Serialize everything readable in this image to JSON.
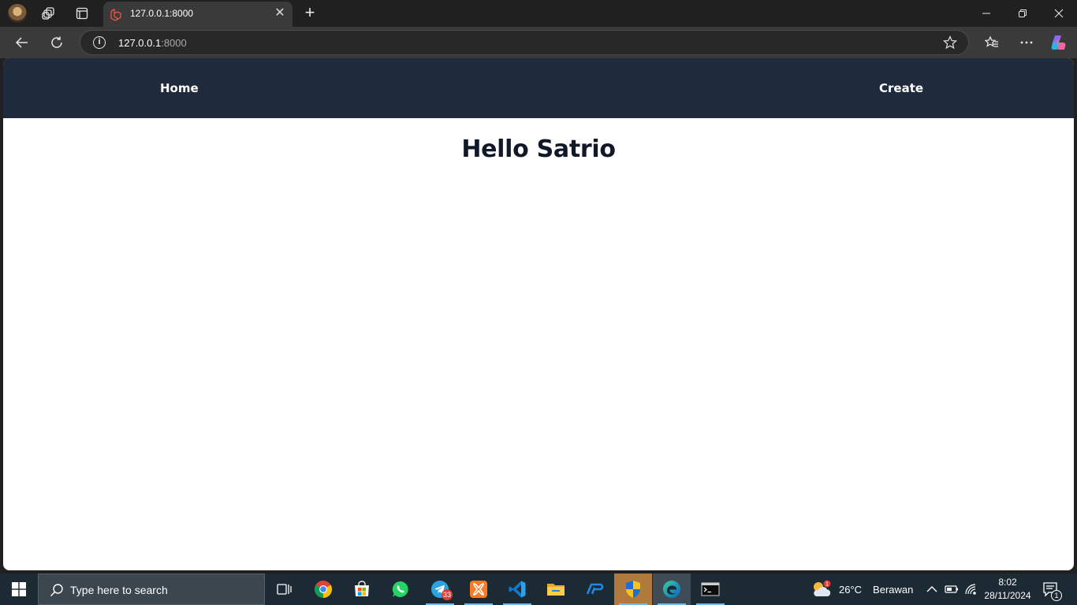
{
  "browser": {
    "tab": {
      "title": "127.0.0.1:8000",
      "favicon": "laravel-icon"
    },
    "address": {
      "host": "127.0.0.1",
      "port": ":8000"
    }
  },
  "page": {
    "nav": {
      "home_label": "Home",
      "create_label": "Create"
    },
    "heading": "Hello Satrio"
  },
  "taskbar": {
    "search_placeholder": "Type here to search",
    "telegram_badge": "33",
    "weather": {
      "alert": "1",
      "temp": "26°C",
      "condition": "Berawan"
    },
    "clock": {
      "time": "8:02",
      "date": "28/11/2024"
    },
    "notification_count": "1"
  },
  "colors": {
    "navbar": "#1f2a3c",
    "heading": "#111827",
    "taskbar": "#1c2a33"
  }
}
